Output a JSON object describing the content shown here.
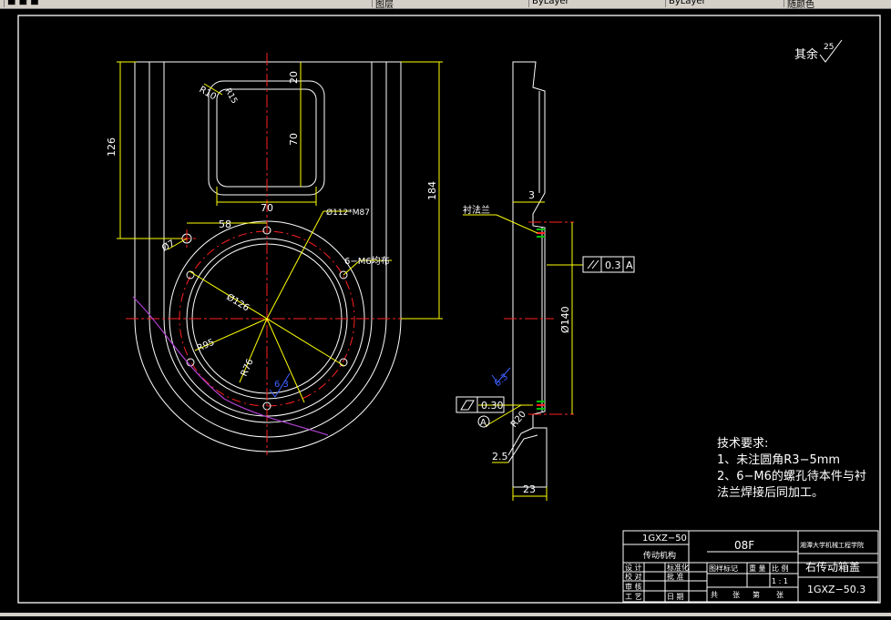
{
  "toolbar": {
    "segments": [
      "■ ■ ■",
      "图层",
      "ByLayer",
      "ByLayer",
      "随颜色"
    ]
  },
  "drawing": {
    "roughness_note": "其余",
    "roughness_value": "25",
    "front_view": {
      "dims": {
        "width_20": "20",
        "height_70": "70",
        "width_70": "70",
        "r10": "R10",
        "r15": "R15",
        "h126": "126",
        "h184": "184",
        "w58": "58",
        "hole7": "Ø7",
        "pcd112": "Ø112*M87",
        "holes_note": "6−M6均布",
        "d126": "Ø126",
        "r95": "R95",
        "r76": "R76",
        "rough_63": "6.3"
      }
    },
    "side_view": {
      "dims": {
        "t3": "3",
        "flange_label": "衬法兰",
        "d140": "Ø140",
        "parallel_value": "0.3",
        "parallel_datum": "A",
        "flatness_value": "0.30",
        "datum_a": "A",
        "r20": "R20",
        "t25": "2.5",
        "w23": "23",
        "rough_side": "6.3"
      }
    },
    "tech_requirements": {
      "title": "技术要求:",
      "line1": "1、未注圆角R3−5mm",
      "line2": "2、6−M6的螺孔待本件与衬",
      "line3": "法兰焊接后同加工。"
    },
    "title_block": {
      "drawing_no_top": "1GXZ−50",
      "material": "08F",
      "company": "湘潭大学机械工程学院",
      "sub_title": "传动机构",
      "stage_label": "图样标记",
      "weight_label": "重 量",
      "scale_label": "比 例",
      "scale_value": "1 : 1",
      "part_name": "右传动箱盖",
      "drawing_no": "1GXZ−50.3",
      "row_labels": [
        "设 计",
        "校 对",
        "审 核",
        "工 艺"
      ],
      "mid_labels": [
        "标准化",
        "批 准",
        "",
        "日 期"
      ],
      "sheets_total_label": "共",
      "sheets_unit": "张",
      "sheet_label": "第",
      "sheet_unit": "张"
    }
  }
}
